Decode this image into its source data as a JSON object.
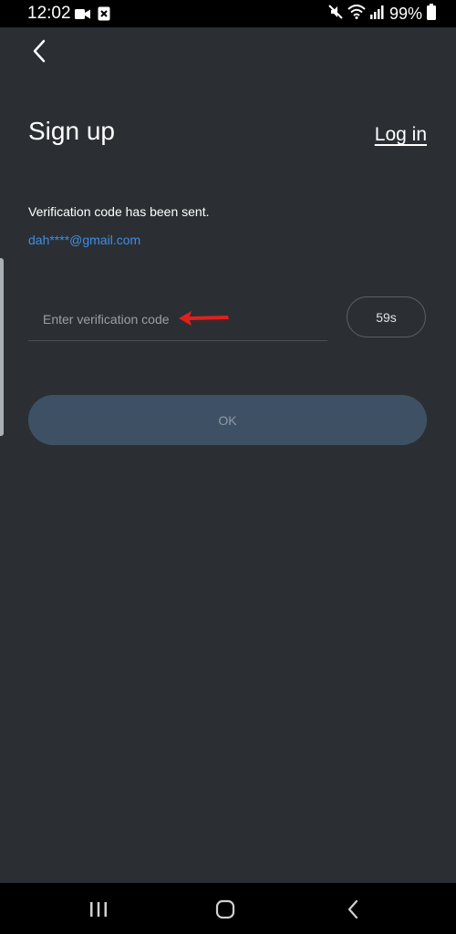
{
  "status_bar": {
    "time": "12:02",
    "battery": "99%",
    "icons": [
      "video-camera-icon",
      "screenshot-icon",
      "mute-icon",
      "wifi-icon",
      "signal-icon",
      "battery-icon"
    ]
  },
  "header": {
    "back_icon": "chevron-left-icon",
    "title": "Sign up",
    "login_label": "Log in"
  },
  "verification": {
    "sent_message": "Verification code has been sent.",
    "email": "dah****@gmail.com",
    "input_placeholder": "Enter verification code",
    "input_value": "",
    "countdown_label": "59s"
  },
  "actions": {
    "ok_label": "OK"
  },
  "nav_bar": {
    "icons": [
      "recent-apps-icon",
      "home-icon",
      "back-icon"
    ]
  },
  "colors": {
    "background": "#2b2f33",
    "accent_link": "#3d8fe6",
    "ok_button": "#3e5164",
    "annotation_arrow": "#e0201c"
  }
}
